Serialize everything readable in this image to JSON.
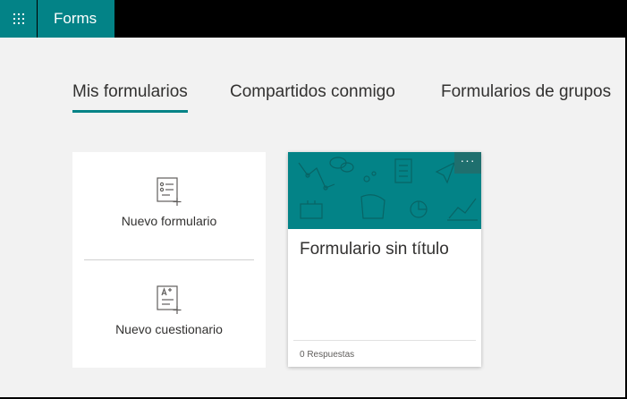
{
  "app": {
    "name": "Forms",
    "accent_color": "#038387",
    "launcher_icon": "waffle-icon"
  },
  "tabs": [
    {
      "label": "Mis formularios",
      "active": true
    },
    {
      "label": "Compartidos conmigo",
      "active": false
    },
    {
      "label": "Formularios de grupos",
      "active": false
    }
  ],
  "new_items": {
    "new_form_label": "Nuevo formulario",
    "new_form_icon": "new-form-icon",
    "new_quiz_label": "Nuevo cuestionario",
    "new_quiz_icon": "new-quiz-icon"
  },
  "form_card": {
    "title": "Formulario sin título",
    "responses": "0 Respuestas",
    "more_label": "···",
    "banner_color": "#038387"
  }
}
